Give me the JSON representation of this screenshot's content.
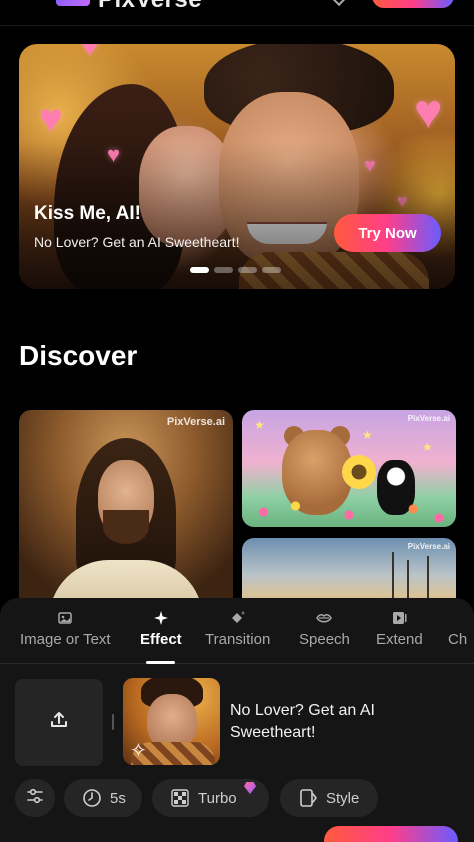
{
  "app": {
    "name": "PixVerse"
  },
  "hero": {
    "title": "Kiss Me, AI!",
    "subtitle": "No Lover? Get an AI Sweetheart!",
    "cta": "Try Now",
    "slides": 4,
    "active_slide": 0
  },
  "discover": {
    "title": "Discover",
    "cards": [
      {
        "watermark": "PixVerse.ai",
        "subject": "portrait"
      },
      {
        "watermark": "PixVerse.ai",
        "subject": "bear-and-cat"
      },
      {
        "watermark": "PixVerse.ai",
        "subject": "sailing-ships"
      }
    ]
  },
  "tabs": [
    {
      "label": "Image or Text",
      "icon": "image-icon"
    },
    {
      "label": "Effect",
      "icon": "sparkle-icon",
      "active": true
    },
    {
      "label": "Transition",
      "icon": "diamond-sparkle-icon"
    },
    {
      "label": "Speech",
      "icon": "lips-icon"
    },
    {
      "label": "Extend",
      "icon": "extend-icon"
    },
    {
      "label": "Ch",
      "icon": "character-icon"
    }
  ],
  "composer": {
    "prompt": "No Lover? Get an AI Sweetheart!",
    "upload_icon": "upload-icon",
    "effect_thumb_icon": "sparkle-icon"
  },
  "options": {
    "duration": "5s",
    "mode": "Turbo",
    "style": "Style"
  },
  "colors": {
    "accent_gradient": [
      "#ff5a3c",
      "#ff3e8a",
      "#6b5cff"
    ],
    "background": "#000000",
    "panel": "#151515",
    "chip": "#252525"
  }
}
